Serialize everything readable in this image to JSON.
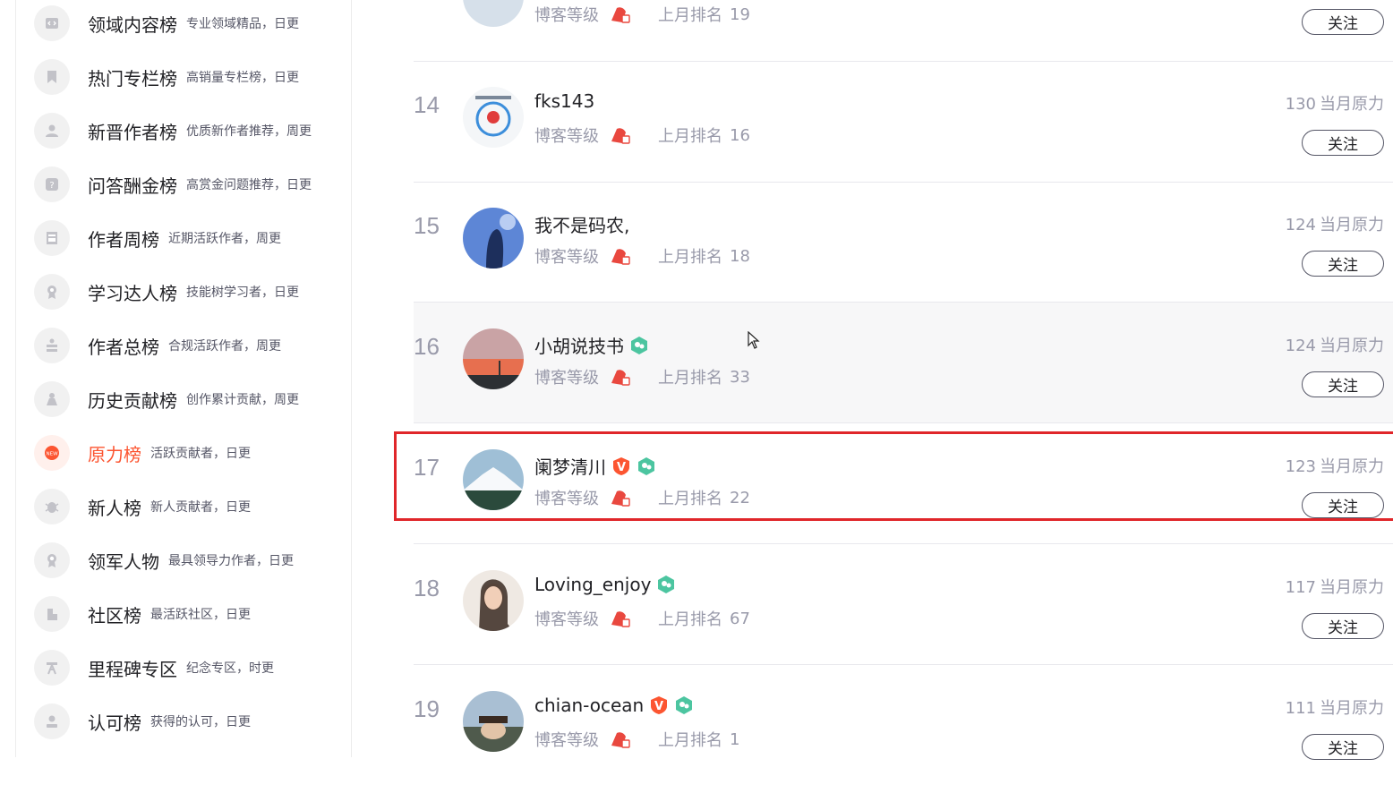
{
  "sidebar": {
    "items": [
      {
        "title": "领域内容榜",
        "desc": "专业领域精品，日更",
        "icon": "code-icon"
      },
      {
        "title": "热门专栏榜",
        "desc": "高销量专栏榜，日更",
        "icon": "bookmark-icon"
      },
      {
        "title": "新晋作者榜",
        "desc": "优质新作者推荐，周更",
        "icon": "user-icon"
      },
      {
        "title": "问答酬金榜",
        "desc": "高赏金问题推荐，日更",
        "icon": "question-icon"
      },
      {
        "title": "作者周榜",
        "desc": "近期活跃作者，周更",
        "icon": "calendar-icon"
      },
      {
        "title": "学习达人榜",
        "desc": "技能树学习者，日更",
        "icon": "medal-icon"
      },
      {
        "title": "作者总榜",
        "desc": "合规活跃作者，周更",
        "icon": "group-icon"
      },
      {
        "title": "历史贡献榜",
        "desc": "创作累计贡献，周更",
        "icon": "hand-icon"
      },
      {
        "title": "原力榜",
        "desc": "活跃贡献者，日更",
        "icon": "new-badge-icon",
        "active": true
      },
      {
        "title": "新人榜",
        "desc": "新人贡献者，日更",
        "icon": "bug-icon"
      },
      {
        "title": "领军人物",
        "desc": "最具领导力作者，日更",
        "icon": "award-icon"
      },
      {
        "title": "社区榜",
        "desc": "最活跃社区，日更",
        "icon": "building-icon"
      },
      {
        "title": "里程碑专区",
        "desc": "纪念专区，时更",
        "icon": "milestone-icon"
      },
      {
        "title": "认可榜",
        "desc": "获得的认可，日更",
        "icon": "person-icon"
      }
    ]
  },
  "common": {
    "level_label": "博客等级",
    "last_rank_label": "上月排名",
    "score_suffix": "当月原力",
    "follow_label": "关注"
  },
  "rows": [
    {
      "rank": "",
      "name": "",
      "last_rank": "19",
      "score": "",
      "partial": true
    },
    {
      "rank": "14",
      "name": "fks143",
      "last_rank": "16",
      "score": "130",
      "v_badge": false,
      "c_badge": false
    },
    {
      "rank": "15",
      "name": "我不是码农,",
      "last_rank": "18",
      "score": "124",
      "v_badge": false,
      "c_badge": false
    },
    {
      "rank": "16",
      "name": "小胡说技书",
      "last_rank": "33",
      "score": "124",
      "v_badge": false,
      "c_badge": true,
      "hover": true
    },
    {
      "rank": "17",
      "name": "阑梦清川",
      "last_rank": "22",
      "score": "123",
      "v_badge": true,
      "c_badge": true,
      "highlighted": true
    },
    {
      "rank": "18",
      "name": "Loving_enjoy",
      "last_rank": "67",
      "score": "117",
      "v_badge": false,
      "c_badge": true
    },
    {
      "rank": "19",
      "name": "chian-ocean",
      "last_rank": "1",
      "score": "111",
      "v_badge": true,
      "c_badge": true
    }
  ],
  "colors": {
    "accent": "#fc5531",
    "highlight_border": "#e0262a",
    "muted_text": "#999aaa",
    "badge_green": "#4cc5a0"
  }
}
